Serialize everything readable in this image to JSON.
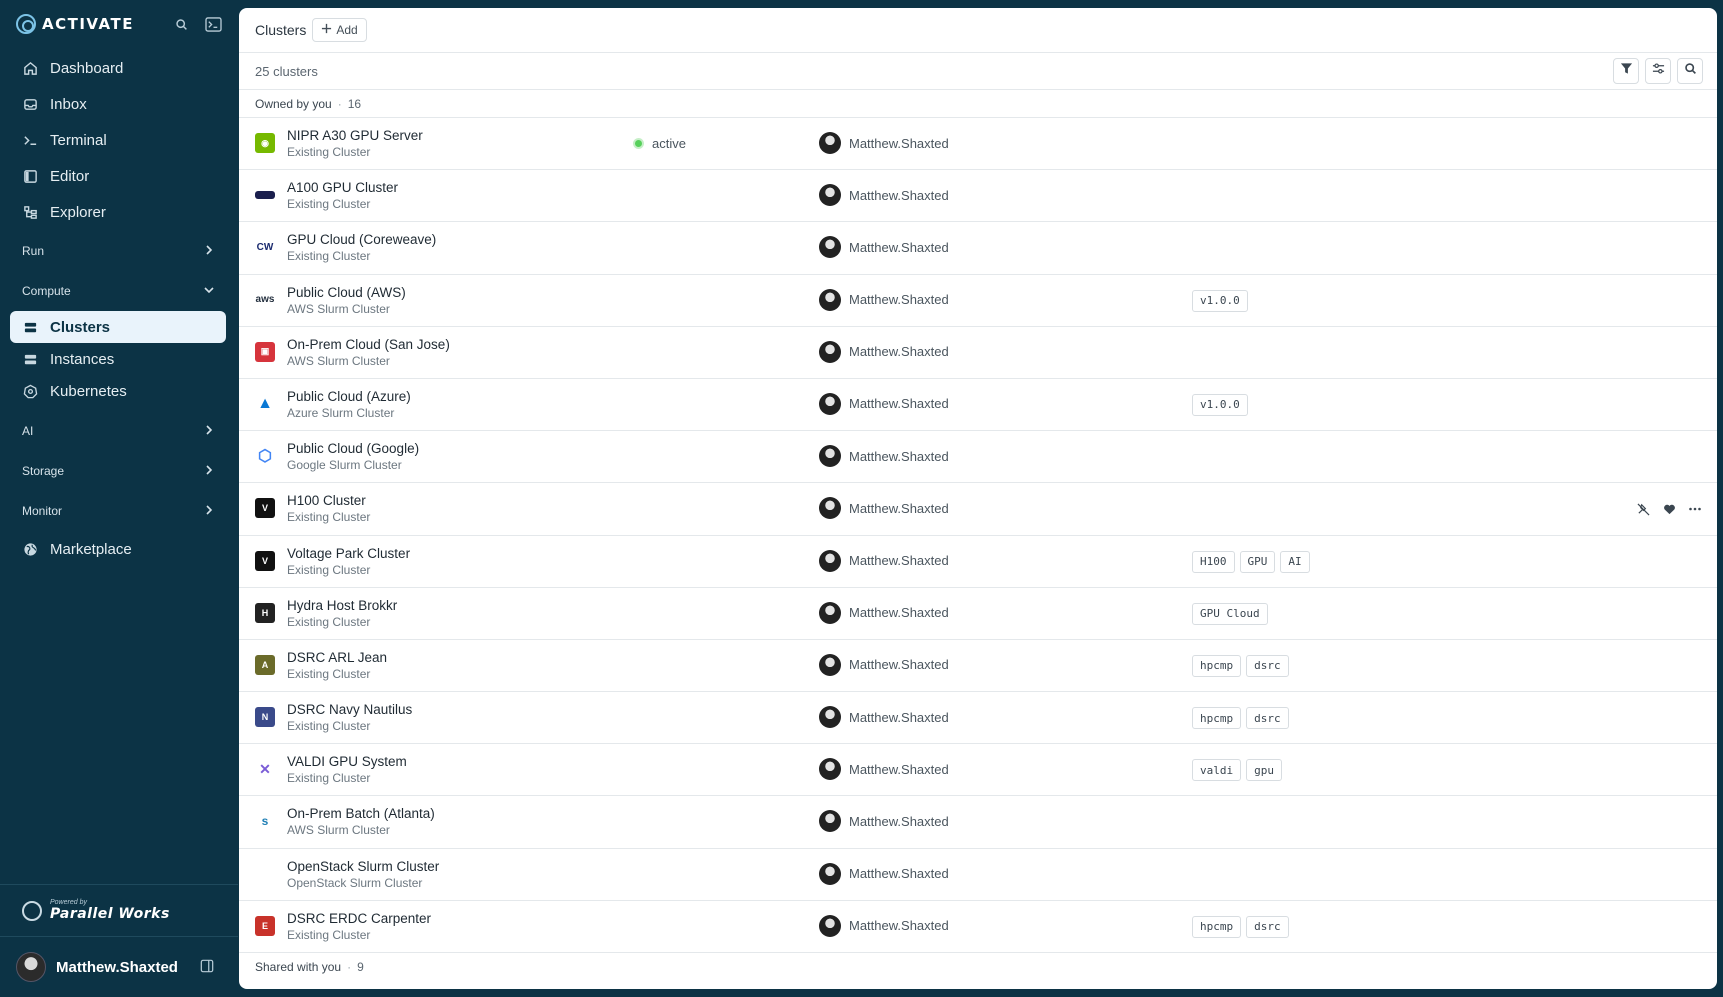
{
  "brand": {
    "name": "ACTIVATE"
  },
  "sidebar": {
    "items": [
      {
        "label": "Dashboard"
      },
      {
        "label": "Inbox"
      },
      {
        "label": "Terminal"
      },
      {
        "label": "Editor"
      },
      {
        "label": "Explorer"
      }
    ],
    "sections": {
      "run": "Run",
      "compute": "Compute",
      "ai": "AI",
      "storage": "Storage",
      "monitor": "Monitor"
    },
    "compute_items": [
      {
        "label": "Clusters",
        "active": true
      },
      {
        "label": "Instances"
      },
      {
        "label": "Kubernetes"
      }
    ],
    "marketplace": "Marketplace",
    "powered_small": "Powered by",
    "powered_name": "Parallel Works",
    "user_name": "Matthew.Shaxted"
  },
  "header": {
    "title": "Clusters",
    "add_label": "Add",
    "count_text": "25 clusters"
  },
  "groups": {
    "owned_label": "Owned by you",
    "owned_count": "16",
    "shared_label": "Shared with you",
    "shared_count": "9"
  },
  "clusters": [
    {
      "name": "NIPR A30 GPU Server",
      "type": "Existing Cluster",
      "status": "active",
      "owner": "Matthew.Shaxted",
      "tags": [],
      "logo": "nvidia-logo-icon",
      "color": "#76b900"
    },
    {
      "name": "A100 GPU Cluster",
      "type": "Existing Cluster",
      "status": "",
      "owner": "Matthew.Shaxted",
      "tags": [],
      "logo": "a100-logo-icon",
      "color": "#1b1f4d"
    },
    {
      "name": "GPU Cloud (Coreweave)",
      "type": "Existing Cluster",
      "status": "",
      "owner": "Matthew.Shaxted",
      "tags": [],
      "logo": "coreweave-logo-icon",
      "color": "#1a2a6e"
    },
    {
      "name": "Public Cloud (AWS)",
      "type": "AWS Slurm Cluster",
      "status": "",
      "owner": "Matthew.Shaxted",
      "tags": [
        "v1.0.0"
      ],
      "logo": "aws-logo-icon",
      "color": "#ff9900"
    },
    {
      "name": "On-Prem Cloud (San Jose)",
      "type": "AWS Slurm Cluster",
      "status": "",
      "owner": "Matthew.Shaxted",
      "tags": [],
      "logo": "onprem-logo-icon",
      "color": "#d6343c"
    },
    {
      "name": "Public Cloud (Azure)",
      "type": "Azure Slurm Cluster",
      "status": "",
      "owner": "Matthew.Shaxted",
      "tags": [
        "v1.0.0"
      ],
      "logo": "azure-logo-icon",
      "color": "#0a78d4"
    },
    {
      "name": "Public Cloud (Google)",
      "type": "Google Slurm Cluster",
      "status": "",
      "owner": "Matthew.Shaxted",
      "tags": [],
      "logo": "google-cloud-logo-icon",
      "color": "#4285f4"
    },
    {
      "name": "H100 Cluster",
      "type": "Existing Cluster",
      "status": "",
      "owner": "Matthew.Shaxted",
      "tags": [],
      "logo": "voltage-logo-icon",
      "color": "#111111",
      "actions": true
    },
    {
      "name": "Voltage Park Cluster",
      "type": "Existing Cluster",
      "status": "",
      "owner": "Matthew.Shaxted",
      "tags": [
        "H100",
        "GPU",
        "AI"
      ],
      "logo": "voltage-logo-icon",
      "color": "#111111"
    },
    {
      "name": "Hydra Host Brokkr",
      "type": "Existing Cluster",
      "status": "",
      "owner": "Matthew.Shaxted",
      "tags": [
        "GPU Cloud"
      ],
      "logo": "hydra-logo-icon",
      "color": "#222222"
    },
    {
      "name": "DSRC ARL Jean",
      "type": "Existing Cluster",
      "status": "",
      "owner": "Matthew.Shaxted",
      "tags": [
        "hpcmp",
        "dsrc"
      ],
      "logo": "arl-logo-icon",
      "color": "#6b6b2a"
    },
    {
      "name": "DSRC Navy Nautilus",
      "type": "Existing Cluster",
      "status": "",
      "owner": "Matthew.Shaxted",
      "tags": [
        "hpcmp",
        "dsrc"
      ],
      "logo": "navy-logo-icon",
      "color": "#3a4a8a"
    },
    {
      "name": "VALDI GPU System",
      "type": "Existing Cluster",
      "status": "",
      "owner": "Matthew.Shaxted",
      "tags": [
        "valdi",
        "gpu"
      ],
      "logo": "valdi-logo-icon",
      "color": "#7a5cd6"
    },
    {
      "name": "On-Prem Batch (Atlanta)",
      "type": "AWS Slurm Cluster",
      "status": "",
      "owner": "Matthew.Shaxted",
      "tags": [],
      "logo": "slurm-logo-icon",
      "color": "#1f7fb5"
    },
    {
      "name": "OpenStack Slurm Cluster",
      "type": "OpenStack Slurm Cluster",
      "status": "",
      "owner": "Matthew.Shaxted",
      "tags": [],
      "logo": "",
      "color": "#ffffff"
    },
    {
      "name": "DSRC ERDC Carpenter",
      "type": "Existing Cluster",
      "status": "",
      "owner": "Matthew.Shaxted",
      "tags": [
        "hpcmp",
        "dsrc"
      ],
      "logo": "erdc-logo-icon",
      "color": "#c8322a"
    }
  ]
}
